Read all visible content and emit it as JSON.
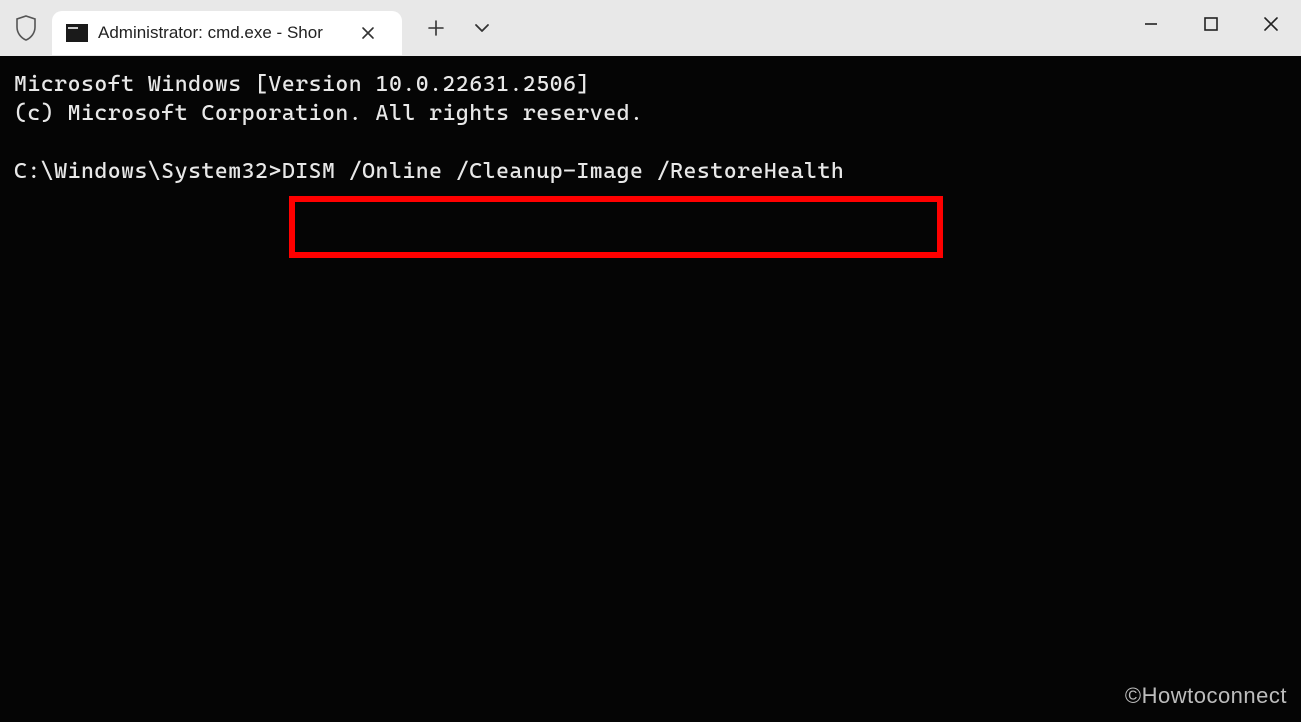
{
  "titlebar": {
    "tab_title": "Administrator: cmd.exe - Shor"
  },
  "terminal": {
    "banner_line1": "Microsoft Windows [Version 10.0.22631.2506]",
    "banner_line2": "(c) Microsoft Corporation. All rights reserved.",
    "prompt": "C:\\Windows\\System32>",
    "command": "DISM /Online /Cleanup-Image /RestoreHealth"
  },
  "watermark": "©Howtoconnect"
}
